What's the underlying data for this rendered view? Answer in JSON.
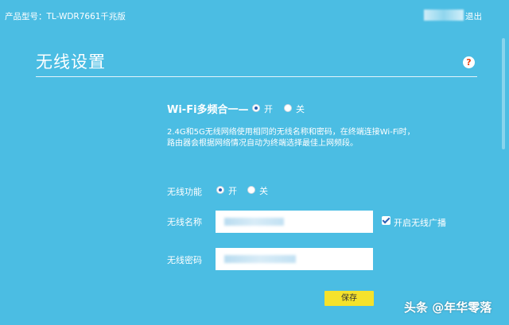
{
  "header": {
    "product_label": "产品型号：TL-WDR7661千兆版",
    "logout_label": "退出"
  },
  "page": {
    "title": "无线设置",
    "help_glyph": "?"
  },
  "wifi_combine": {
    "label": "Wi-Fi多频合一",
    "options": [
      "开",
      "关"
    ],
    "selected": "开",
    "description_line1": "2.4G和5G无线网络使用相同的无线名称和密码，在终端连接Wi-Fi时，",
    "description_line2": "路由器会根据网络情况自动为终端选择最佳上网频段。"
  },
  "wireless_function": {
    "label": "无线功能",
    "options": [
      "开",
      "关"
    ],
    "selected": "开"
  },
  "ssid": {
    "label": "无线名称",
    "broadcast_checkbox_label": "开启无线广播",
    "broadcast_checked": true
  },
  "password": {
    "label": "无线密码"
  },
  "save_label": "保存",
  "watermark": "头条 @年华零落",
  "colors": {
    "background": "#4bbde3",
    "save_button": "#f5e22b",
    "radio_dot": "#2a5fb5",
    "help_icon": "#e8400f"
  }
}
